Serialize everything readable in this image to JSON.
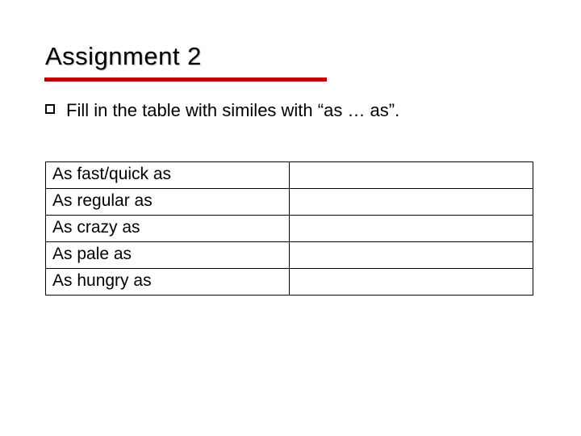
{
  "title": "Assignment 2",
  "bullet": "Fill in the table with similes with “as … as”.",
  "table": {
    "rows": [
      {
        "left": "As fast/quick as",
        "right": ""
      },
      {
        "left": "As regular as",
        "right": ""
      },
      {
        "left": "As crazy as",
        "right": ""
      },
      {
        "left": "As pale as",
        "right": ""
      },
      {
        "left": "As hungry as",
        "right": ""
      }
    ]
  }
}
